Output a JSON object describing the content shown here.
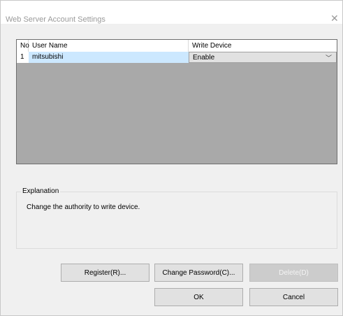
{
  "window": {
    "title": "Web Server Account Settings"
  },
  "table": {
    "headers": {
      "no": "No",
      "user_name": "User Name",
      "write_device": "Write Device"
    },
    "rows": [
      {
        "no": "1",
        "user_name": "mitsubishi",
        "write_device": "Enable"
      }
    ]
  },
  "explanation": {
    "label": "Explanation",
    "text": "Change the authority to write device."
  },
  "buttons": {
    "register": "Register(R)...",
    "change_password": "Change Password(C)...",
    "delete": "Delete(D)",
    "ok": "OK",
    "cancel": "Cancel"
  },
  "colors": {
    "selected_cell": "#cce8ff",
    "grid_empty_area": "#a9a9a9"
  },
  "icons": {
    "close": "close-icon",
    "dropdown": "chevron-down-icon"
  }
}
